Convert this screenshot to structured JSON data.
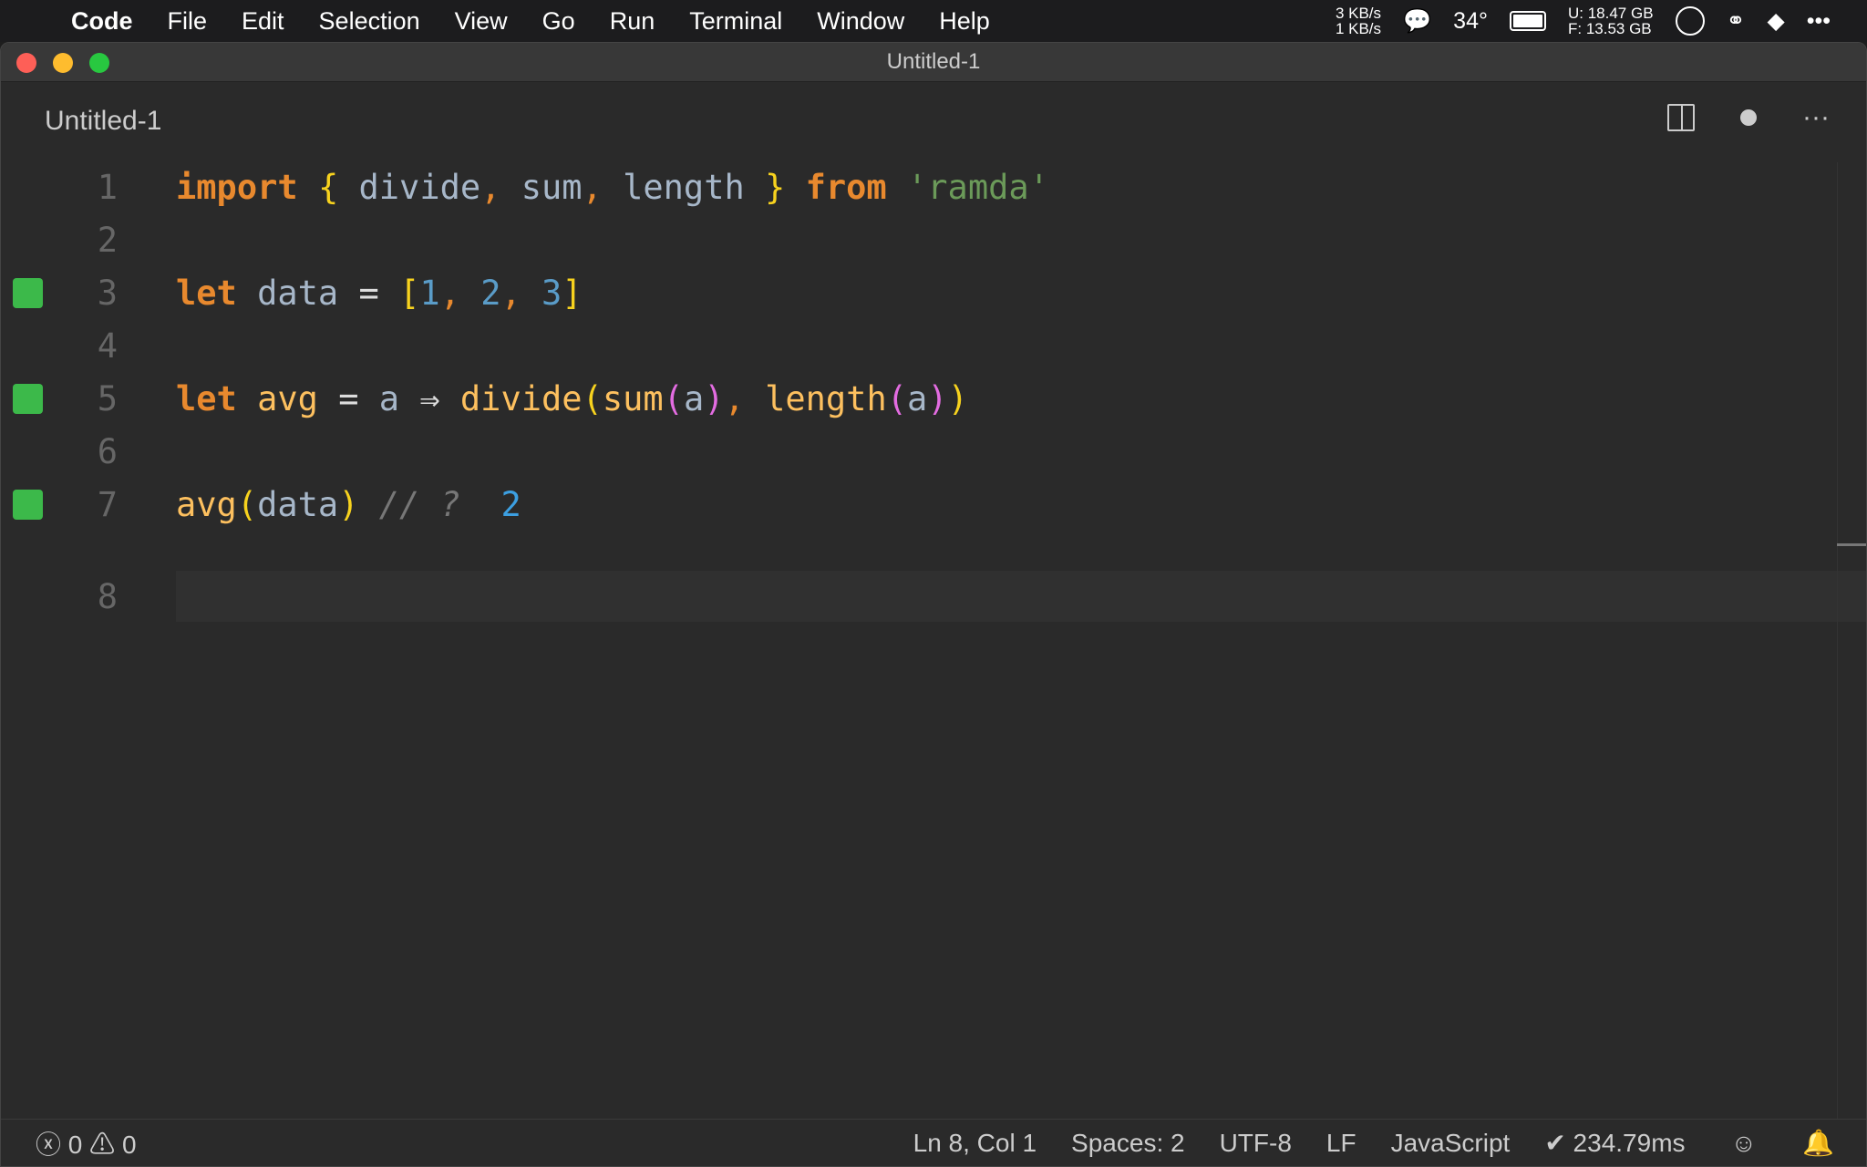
{
  "menubar": {
    "app": "Code",
    "items": [
      "File",
      "Edit",
      "Selection",
      "View",
      "Go",
      "Run",
      "Terminal",
      "Window",
      "Help"
    ],
    "tray": {
      "net_up": "3 KB/s",
      "net_down": "1 KB/s",
      "temp": "34°",
      "disk_u": "U:  18.47 GB",
      "disk_f": "F:  13.53 GB"
    }
  },
  "window": {
    "title": "Untitled-1",
    "tab": "Untitled-1"
  },
  "editor": {
    "line_numbers": [
      "1",
      "2",
      "3",
      "4",
      "5",
      "6",
      "7",
      "8"
    ],
    "current_line": 8,
    "coverage_lines": [
      3,
      5,
      7
    ],
    "inline_result": "2"
  },
  "status": {
    "errors": "0",
    "warnings": "0",
    "position": "Ln 8, Col 1",
    "spaces": "Spaces: 2",
    "encoding": "UTF-8",
    "eol": "LF",
    "language": "JavaScript",
    "timing": "✔ 234.79ms"
  },
  "colors": {
    "coverage": "#3cb94a",
    "keyword": "#e8892e",
    "string": "#6b9a59"
  }
}
